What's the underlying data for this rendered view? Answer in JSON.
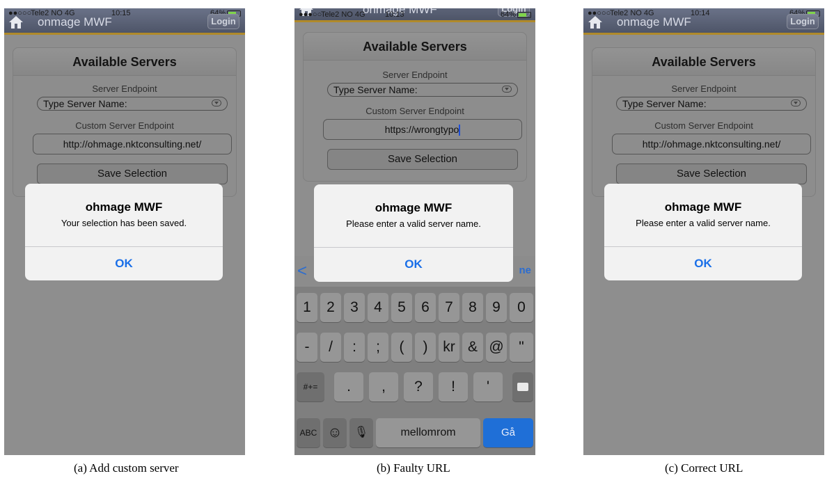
{
  "panels": [
    {
      "status": {
        "signal": "●●○○○",
        "carrier": "Tele2 NO  4G",
        "time": "10:15",
        "battery": "64%"
      },
      "nav": {
        "title": "onmage MWF",
        "login": "Login"
      },
      "card": {
        "title": "Available Servers",
        "endpoint_label": "Server Endpoint",
        "endpoint_value": "Type Server Name:",
        "custom_label": "Custom Server Endpoint",
        "custom_value": "http://ohmage.nktconsulting.net/",
        "save": "Save Selection"
      },
      "alert": {
        "title": "ohmage MWF",
        "message": "Your selection has been saved.",
        "button": "OK"
      },
      "caption": "(a)  Add custom server"
    },
    {
      "status": {
        "signal": "●●●○○",
        "carrier": "Tele2 NO  4G",
        "time": "10:13",
        "battery": "64%"
      },
      "nav": {
        "title": "ohmage MWF",
        "login": "Login"
      },
      "card": {
        "title": "Available Servers",
        "endpoint_label": "Server Endpoint",
        "endpoint_value": "Type Server Name:",
        "custom_label": "Custom Server Endpoint",
        "custom_value": "https://wrongtypo",
        "save": "Save Selection"
      },
      "alert": {
        "title": "ohmage MWF",
        "message": "Please enter a valid server name.",
        "button": "OK"
      },
      "keyboard_bar": {
        "prev": "<",
        "done": "ne"
      },
      "keyboard": {
        "row1": [
          "1",
          "2",
          "3",
          "4",
          "5",
          "6",
          "7",
          "8",
          "9",
          "0"
        ],
        "row2": [
          "-",
          "/",
          ":",
          ";",
          "(",
          ")",
          "kr",
          "&",
          "@",
          "\""
        ],
        "shift": "#+=",
        "row3": [
          ".",
          ",",
          "?",
          "!",
          "'"
        ],
        "abc": "ABC",
        "emoji": "☺",
        "mic": "🎙",
        "space": "mellomrom",
        "go": "Gå"
      },
      "caption": "(b)  Faulty URL"
    },
    {
      "status": {
        "signal": "●●○○○",
        "carrier": "Tele2 NO  4G",
        "time": "10:14",
        "battery": "64%"
      },
      "nav": {
        "title": "onmage MWF",
        "login": "Login"
      },
      "card": {
        "title": "Available Servers",
        "endpoint_label": "Server Endpoint",
        "endpoint_value": "Type Server Name:",
        "custom_label": "Custom Server Endpoint",
        "custom_value": "http://ohmage.nktconsulting.net/",
        "save": "Save Selection"
      },
      "alert": {
        "title": "ohmage MWF",
        "message": "Please enter a valid server name.",
        "button": "OK"
      },
      "caption": "(c)  Correct URL"
    }
  ],
  "colors": {
    "dim_overlay": "#8e8e8e",
    "accent": "#1a6fe8",
    "nav_border": "#b08a2a",
    "go_key": "#1f6fd7"
  }
}
